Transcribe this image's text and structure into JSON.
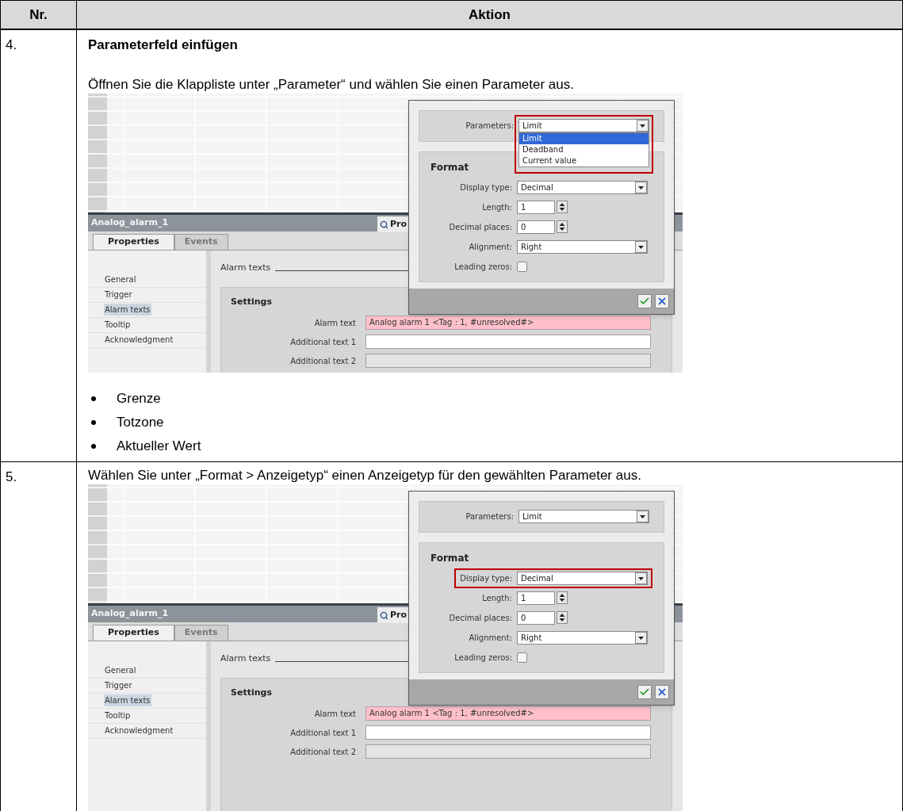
{
  "table": {
    "columns": [
      "Nr.",
      "Aktion"
    ],
    "rows": [
      {
        "number": "4.",
        "title": "Parameterfeld einfügen",
        "instruction": "Öffnen Sie die Klappliste unter „Parameter“ und wählen Sie einen Parameter aus.",
        "screenshot": {
          "object_title": "Analog_alarm_1",
          "view_tab": "Pro",
          "tabs": [
            {
              "label": "Properties",
              "selected": true
            },
            {
              "label": "Events",
              "selected": false
            }
          ],
          "nav_items": [
            {
              "label": "General",
              "selected": false
            },
            {
              "label": "Trigger",
              "selected": false
            },
            {
              "label": "Alarm texts",
              "selected": true
            },
            {
              "label": "Tooltip",
              "selected": false
            },
            {
              "label": "Acknowledgment",
              "selected": false
            }
          ],
          "section_title": "Alarm texts",
          "settings_title": "Settings",
          "fields": [
            {
              "label": "Alarm text",
              "value": "Analog alarm 1 <Tag : 1, #unresolved#>",
              "kind": "error"
            },
            {
              "label": "Additional text 1",
              "kind": "editable"
            },
            {
              "label": "Additional text 2",
              "kind": "readonly"
            }
          ],
          "dialog": {
            "parameters": {
              "label": "Parameters:",
              "value": "Limit",
              "highlighted": true,
              "options": [
                {
                  "label": "Limit",
                  "selected": true
                },
                {
                  "label": "Deadband",
                  "selected": false
                },
                {
                  "label": "Current value",
                  "selected": false
                }
              ]
            },
            "format_title": "Format",
            "format_fields": [
              {
                "label": "Display type:",
                "value": "Decimal",
                "kind": "dropdown",
                "highlighted": false
              },
              {
                "label": "Length:",
                "value": "1",
                "kind": "spinner",
                "highlighted": false
              },
              {
                "label": "Decimal places:",
                "value": "0",
                "kind": "spinner",
                "highlighted": false
              },
              {
                "label": "Alignment:",
                "value": "Right",
                "kind": "dropdown",
                "highlighted": false
              },
              {
                "label": "Leading zeros:",
                "kind": "checkbox",
                "checked": false,
                "highlighted": false
              }
            ]
          }
        },
        "bullets": [
          "Grenze",
          "Totzone",
          "Aktueller Wert"
        ]
      },
      {
        "number": "5.",
        "instruction": "Wählen Sie unter „Format > Anzeigetyp“ einen Anzeigetyp für den gewählten Parameter aus.",
        "screenshot": {
          "object_title": "Analog_alarm_1",
          "view_tab": "Pro",
          "tabs": [
            {
              "label": "Properties",
              "selected": true
            },
            {
              "label": "Events",
              "selected": false
            }
          ],
          "nav_items": [
            {
              "label": "General",
              "selected": false
            },
            {
              "label": "Trigger",
              "selected": false
            },
            {
              "label": "Alarm texts",
              "selected": true
            },
            {
              "label": "Tooltip",
              "selected": false
            },
            {
              "label": "Acknowledgment",
              "selected": false
            }
          ],
          "section_title": "Alarm texts",
          "settings_title": "Settings",
          "fields": [
            {
              "label": "Alarm text",
              "value": "Analog alarm 1 <Tag : 1, #unresolved#>",
              "kind": "error"
            },
            {
              "label": "Additional text 1",
              "kind": "editable"
            },
            {
              "label": "Additional text 2",
              "kind": "readonly"
            }
          ],
          "dialog": {
            "parameters": {
              "label": "Parameters:",
              "value": "Limit",
              "highlighted": false
            },
            "format_title": "Format",
            "format_fields": [
              {
                "label": "Display type:",
                "value": "Decimal",
                "kind": "dropdown",
                "highlighted": true
              },
              {
                "label": "Length:",
                "value": "1",
                "kind": "spinner",
                "highlighted": false
              },
              {
                "label": "Decimal places:",
                "value": "0",
                "kind": "spinner",
                "highlighted": false
              },
              {
                "label": "Alignment:",
                "value": "Right",
                "kind": "dropdown",
                "highlighted": false
              },
              {
                "label": "Leading zeros:",
                "kind": "checkbox",
                "checked": false,
                "highlighted": false
              }
            ]
          }
        }
      }
    ]
  }
}
